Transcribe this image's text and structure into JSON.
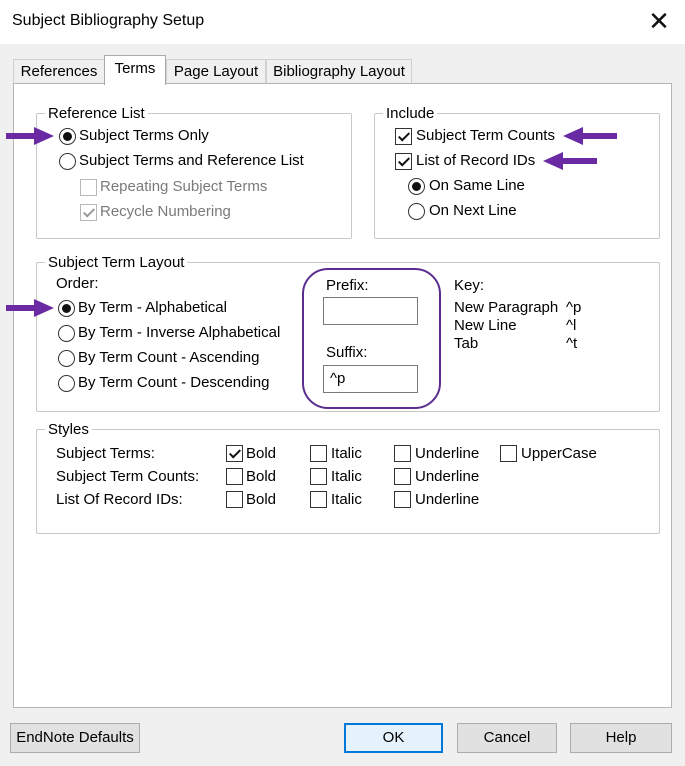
{
  "window": {
    "title": "Subject Bibliography Setup",
    "close_glyph": "✕"
  },
  "tabs": [
    "References",
    "Terms",
    "Page Layout",
    "Bibliography Layout"
  ],
  "reference_list": {
    "legend": "Reference List",
    "options": [
      "Subject Terms Only",
      "Subject Terms and Reference List"
    ],
    "sub_options": [
      "Repeating Subject Terms",
      "Recycle Numbering"
    ]
  },
  "include": {
    "legend": "Include",
    "checks": [
      "Subject Term Counts",
      "List of Record IDs"
    ],
    "options": [
      "On Same Line",
      "On Next Line"
    ]
  },
  "layout": {
    "legend": "Subject Term Layout",
    "order_label": "Order:",
    "orders": [
      "By Term - Alphabetical",
      "By Term - Inverse Alphabetical",
      "By Term Count - Ascending",
      "By Term Count - Descending"
    ],
    "prefix_label": "Prefix:",
    "prefix_value": "",
    "suffix_label": "Suffix:",
    "suffix_value": "^p",
    "key_label": "Key:",
    "keys": [
      {
        "name": "New Paragraph",
        "code": "^p"
      },
      {
        "name": "New Line",
        "code": "^l"
      },
      {
        "name": "Tab",
        "code": "^t"
      }
    ]
  },
  "styles": {
    "legend": "Styles",
    "rows": [
      "Subject Terms:",
      "Subject Term Counts:",
      "List Of Record IDs:"
    ],
    "bold": "Bold",
    "italic": "Italic",
    "underline": "Underline",
    "uppercase": "UpperCase"
  },
  "buttons": {
    "defaults": "EndNote Defaults",
    "ok": "OK",
    "cancel": "Cancel",
    "help": "Help"
  },
  "colors": {
    "annotation": "#6a2aa3",
    "focus_blue": "#0078d7"
  }
}
